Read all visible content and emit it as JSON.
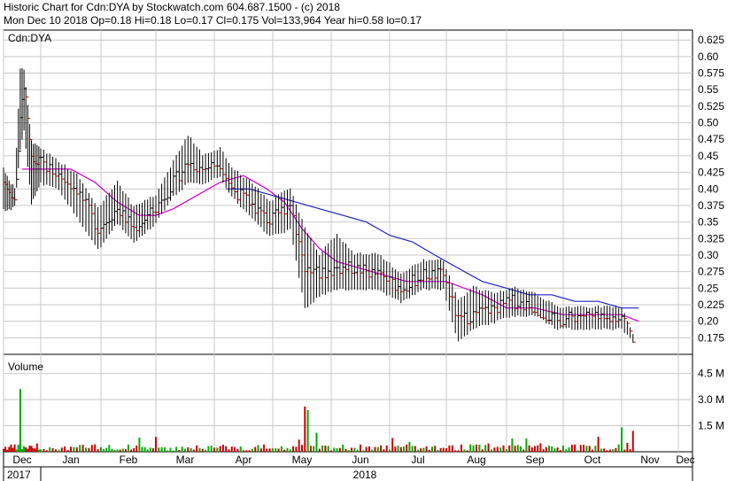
{
  "header": {
    "line1": "Historic Chart for Cdn:DYA by Stockwatch.com 604.687.1500 - (c) 2018",
    "line2": "Mon Dec 10 2018   Op=0.18  Hi=0.18  Lo=0.17  Cl=0.175  Vol=133,964  Year hi=0.58  lo=0.17"
  },
  "chart_data": {
    "type": "bar",
    "title": "Historic Chart for Cdn:DYA",
    "symbol": "Cdn:DYA",
    "volume_label": "Volume",
    "price_ticks": [
      "0.625",
      "0.60",
      "0.575",
      "0.55",
      "0.525",
      "0.50",
      "0.475",
      "0.45",
      "0.425",
      "0.40",
      "0.375",
      "0.35",
      "0.325",
      "0.30",
      "0.275",
      "0.25",
      "0.225",
      "0.20",
      "0.175"
    ],
    "price_ylim": [
      0.15,
      0.64
    ],
    "volume_ticks": [
      "4.5 M",
      "3.0 M",
      "1.5 M"
    ],
    "volume_ylim": [
      0,
      5.6
    ],
    "months": [
      "Dec",
      "Jan",
      "Feb",
      "Mar",
      "Apr",
      "May",
      "Jun",
      "Jul",
      "Aug",
      "Sep",
      "Oct",
      "Nov",
      "Dec"
    ],
    "years": [
      "2017",
      "2018"
    ],
    "ohlc_anchors": [
      {
        "month": 0,
        "close": 0.41,
        "high": 0.43,
        "low": 0.37
      },
      {
        "month": 0.15,
        "close": 0.4,
        "high": 0.41,
        "low": 0.37
      },
      {
        "month": 0.3,
        "close": 0.38,
        "high": 0.4,
        "low": 0.375
      },
      {
        "month": 0.45,
        "close": 0.5,
        "high": 0.58,
        "low": 0.46
      },
      {
        "month": 0.55,
        "close": 0.56,
        "high": 0.58,
        "low": 0.49
      },
      {
        "month": 0.75,
        "close": 0.44,
        "high": 0.47,
        "low": 0.38
      },
      {
        "month": 1.0,
        "close": 0.44,
        "high": 0.46,
        "low": 0.41
      },
      {
        "month": 1.3,
        "close": 0.42,
        "high": 0.44,
        "low": 0.4
      },
      {
        "month": 1.6,
        "close": 0.4,
        "high": 0.42,
        "low": 0.36
      },
      {
        "month": 1.95,
        "close": 0.34,
        "high": 0.37,
        "low": 0.31
      },
      {
        "month": 2.3,
        "close": 0.37,
        "high": 0.41,
        "low": 0.35
      },
      {
        "month": 2.6,
        "close": 0.34,
        "high": 0.37,
        "low": 0.32
      },
      {
        "month": 3.0,
        "close": 0.37,
        "high": 0.39,
        "low": 0.35
      },
      {
        "month": 3.3,
        "close": 0.41,
        "high": 0.44,
        "low": 0.39
      },
      {
        "month": 3.55,
        "close": 0.44,
        "high": 0.48,
        "low": 0.41
      },
      {
        "month": 3.8,
        "close": 0.43,
        "high": 0.45,
        "low": 0.41
      },
      {
        "month": 4.1,
        "close": 0.44,
        "high": 0.46,
        "low": 0.42
      },
      {
        "month": 4.3,
        "close": 0.4,
        "high": 0.43,
        "low": 0.39
      },
      {
        "month": 4.6,
        "close": 0.38,
        "high": 0.41,
        "low": 0.36
      },
      {
        "month": 4.95,
        "close": 0.35,
        "high": 0.38,
        "low": 0.33
      },
      {
        "month": 5.3,
        "close": 0.38,
        "high": 0.4,
        "low": 0.34
      },
      {
        "month": 5.55,
        "close": 0.28,
        "high": 0.34,
        "low": 0.22
      },
      {
        "month": 5.8,
        "close": 0.27,
        "high": 0.3,
        "low": 0.24
      },
      {
        "month": 6.1,
        "close": 0.28,
        "high": 0.33,
        "low": 0.25
      },
      {
        "month": 6.4,
        "close": 0.28,
        "high": 0.3,
        "low": 0.25
      },
      {
        "month": 6.8,
        "close": 0.27,
        "high": 0.3,
        "low": 0.25
      },
      {
        "month": 7.2,
        "close": 0.25,
        "high": 0.27,
        "low": 0.23
      },
      {
        "month": 7.6,
        "close": 0.27,
        "high": 0.29,
        "low": 0.25
      },
      {
        "month": 7.95,
        "close": 0.27,
        "high": 0.29,
        "low": 0.25
      },
      {
        "month": 8.2,
        "close": 0.2,
        "high": 0.23,
        "low": 0.17
      },
      {
        "month": 8.45,
        "close": 0.21,
        "high": 0.25,
        "low": 0.19
      },
      {
        "month": 8.8,
        "close": 0.22,
        "high": 0.24,
        "low": 0.2
      },
      {
        "month": 9.1,
        "close": 0.23,
        "high": 0.25,
        "low": 0.21
      },
      {
        "month": 9.5,
        "close": 0.22,
        "high": 0.24,
        "low": 0.21
      },
      {
        "month": 9.9,
        "close": 0.2,
        "high": 0.22,
        "low": 0.19
      },
      {
        "month": 10.3,
        "close": 0.21,
        "high": 0.22,
        "low": 0.19
      },
      {
        "month": 10.7,
        "close": 0.2,
        "high": 0.22,
        "low": 0.19
      },
      {
        "month": 11.0,
        "close": 0.21,
        "high": 0.22,
        "low": 0.19
      },
      {
        "month": 11.2,
        "close": 0.175,
        "high": 0.18,
        "low": 0.17
      }
    ],
    "ma_short": [
      [
        0.5,
        0.43
      ],
      [
        1.0,
        0.43
      ],
      [
        1.5,
        0.43
      ],
      [
        1.9,
        0.41
      ],
      [
        2.3,
        0.38
      ],
      [
        2.7,
        0.36
      ],
      [
        3.0,
        0.36
      ],
      [
        3.3,
        0.37
      ],
      [
        3.7,
        0.39
      ],
      [
        4.1,
        0.41
      ],
      [
        4.5,
        0.42
      ],
      [
        4.9,
        0.4
      ],
      [
        5.2,
        0.38
      ],
      [
        5.5,
        0.34
      ],
      [
        5.8,
        0.31
      ],
      [
        6.1,
        0.29
      ],
      [
        6.5,
        0.28
      ],
      [
        6.9,
        0.27
      ],
      [
        7.3,
        0.26
      ],
      [
        7.7,
        0.26
      ],
      [
        8.0,
        0.26
      ],
      [
        8.3,
        0.25
      ],
      [
        8.6,
        0.24
      ],
      [
        9.0,
        0.22
      ],
      [
        9.5,
        0.22
      ],
      [
        10.0,
        0.21
      ],
      [
        10.5,
        0.21
      ],
      [
        11.0,
        0.21
      ],
      [
        11.3,
        0.2
      ]
    ],
    "ma_long": [
      [
        4.2,
        0.4
      ],
      [
        4.6,
        0.4
      ],
      [
        5.0,
        0.39
      ],
      [
        5.4,
        0.38
      ],
      [
        5.8,
        0.37
      ],
      [
        6.2,
        0.36
      ],
      [
        6.6,
        0.35
      ],
      [
        7.0,
        0.33
      ],
      [
        7.4,
        0.32
      ],
      [
        7.8,
        0.3
      ],
      [
        8.2,
        0.28
      ],
      [
        8.6,
        0.26
      ],
      [
        9.0,
        0.25
      ],
      [
        9.4,
        0.24
      ],
      [
        9.8,
        0.24
      ],
      [
        10.2,
        0.23
      ],
      [
        10.6,
        0.23
      ],
      [
        11.0,
        0.22
      ],
      [
        11.3,
        0.22
      ]
    ],
    "volume_peaks": [
      {
        "month": 0.45,
        "value": 3.6
      },
      {
        "month": 5.55,
        "value": 2.6
      },
      {
        "month": 5.6,
        "value": 2.4
      },
      {
        "month": 11.0,
        "value": 1.4
      }
    ],
    "colors": {
      "up": "#000000",
      "down": "#cc0000",
      "ma_short": "#d400d4",
      "ma_long": "#2020c0",
      "volume_up": "#00aa00",
      "volume_down": "#cc0000",
      "grid": "#c8c8c8"
    }
  }
}
